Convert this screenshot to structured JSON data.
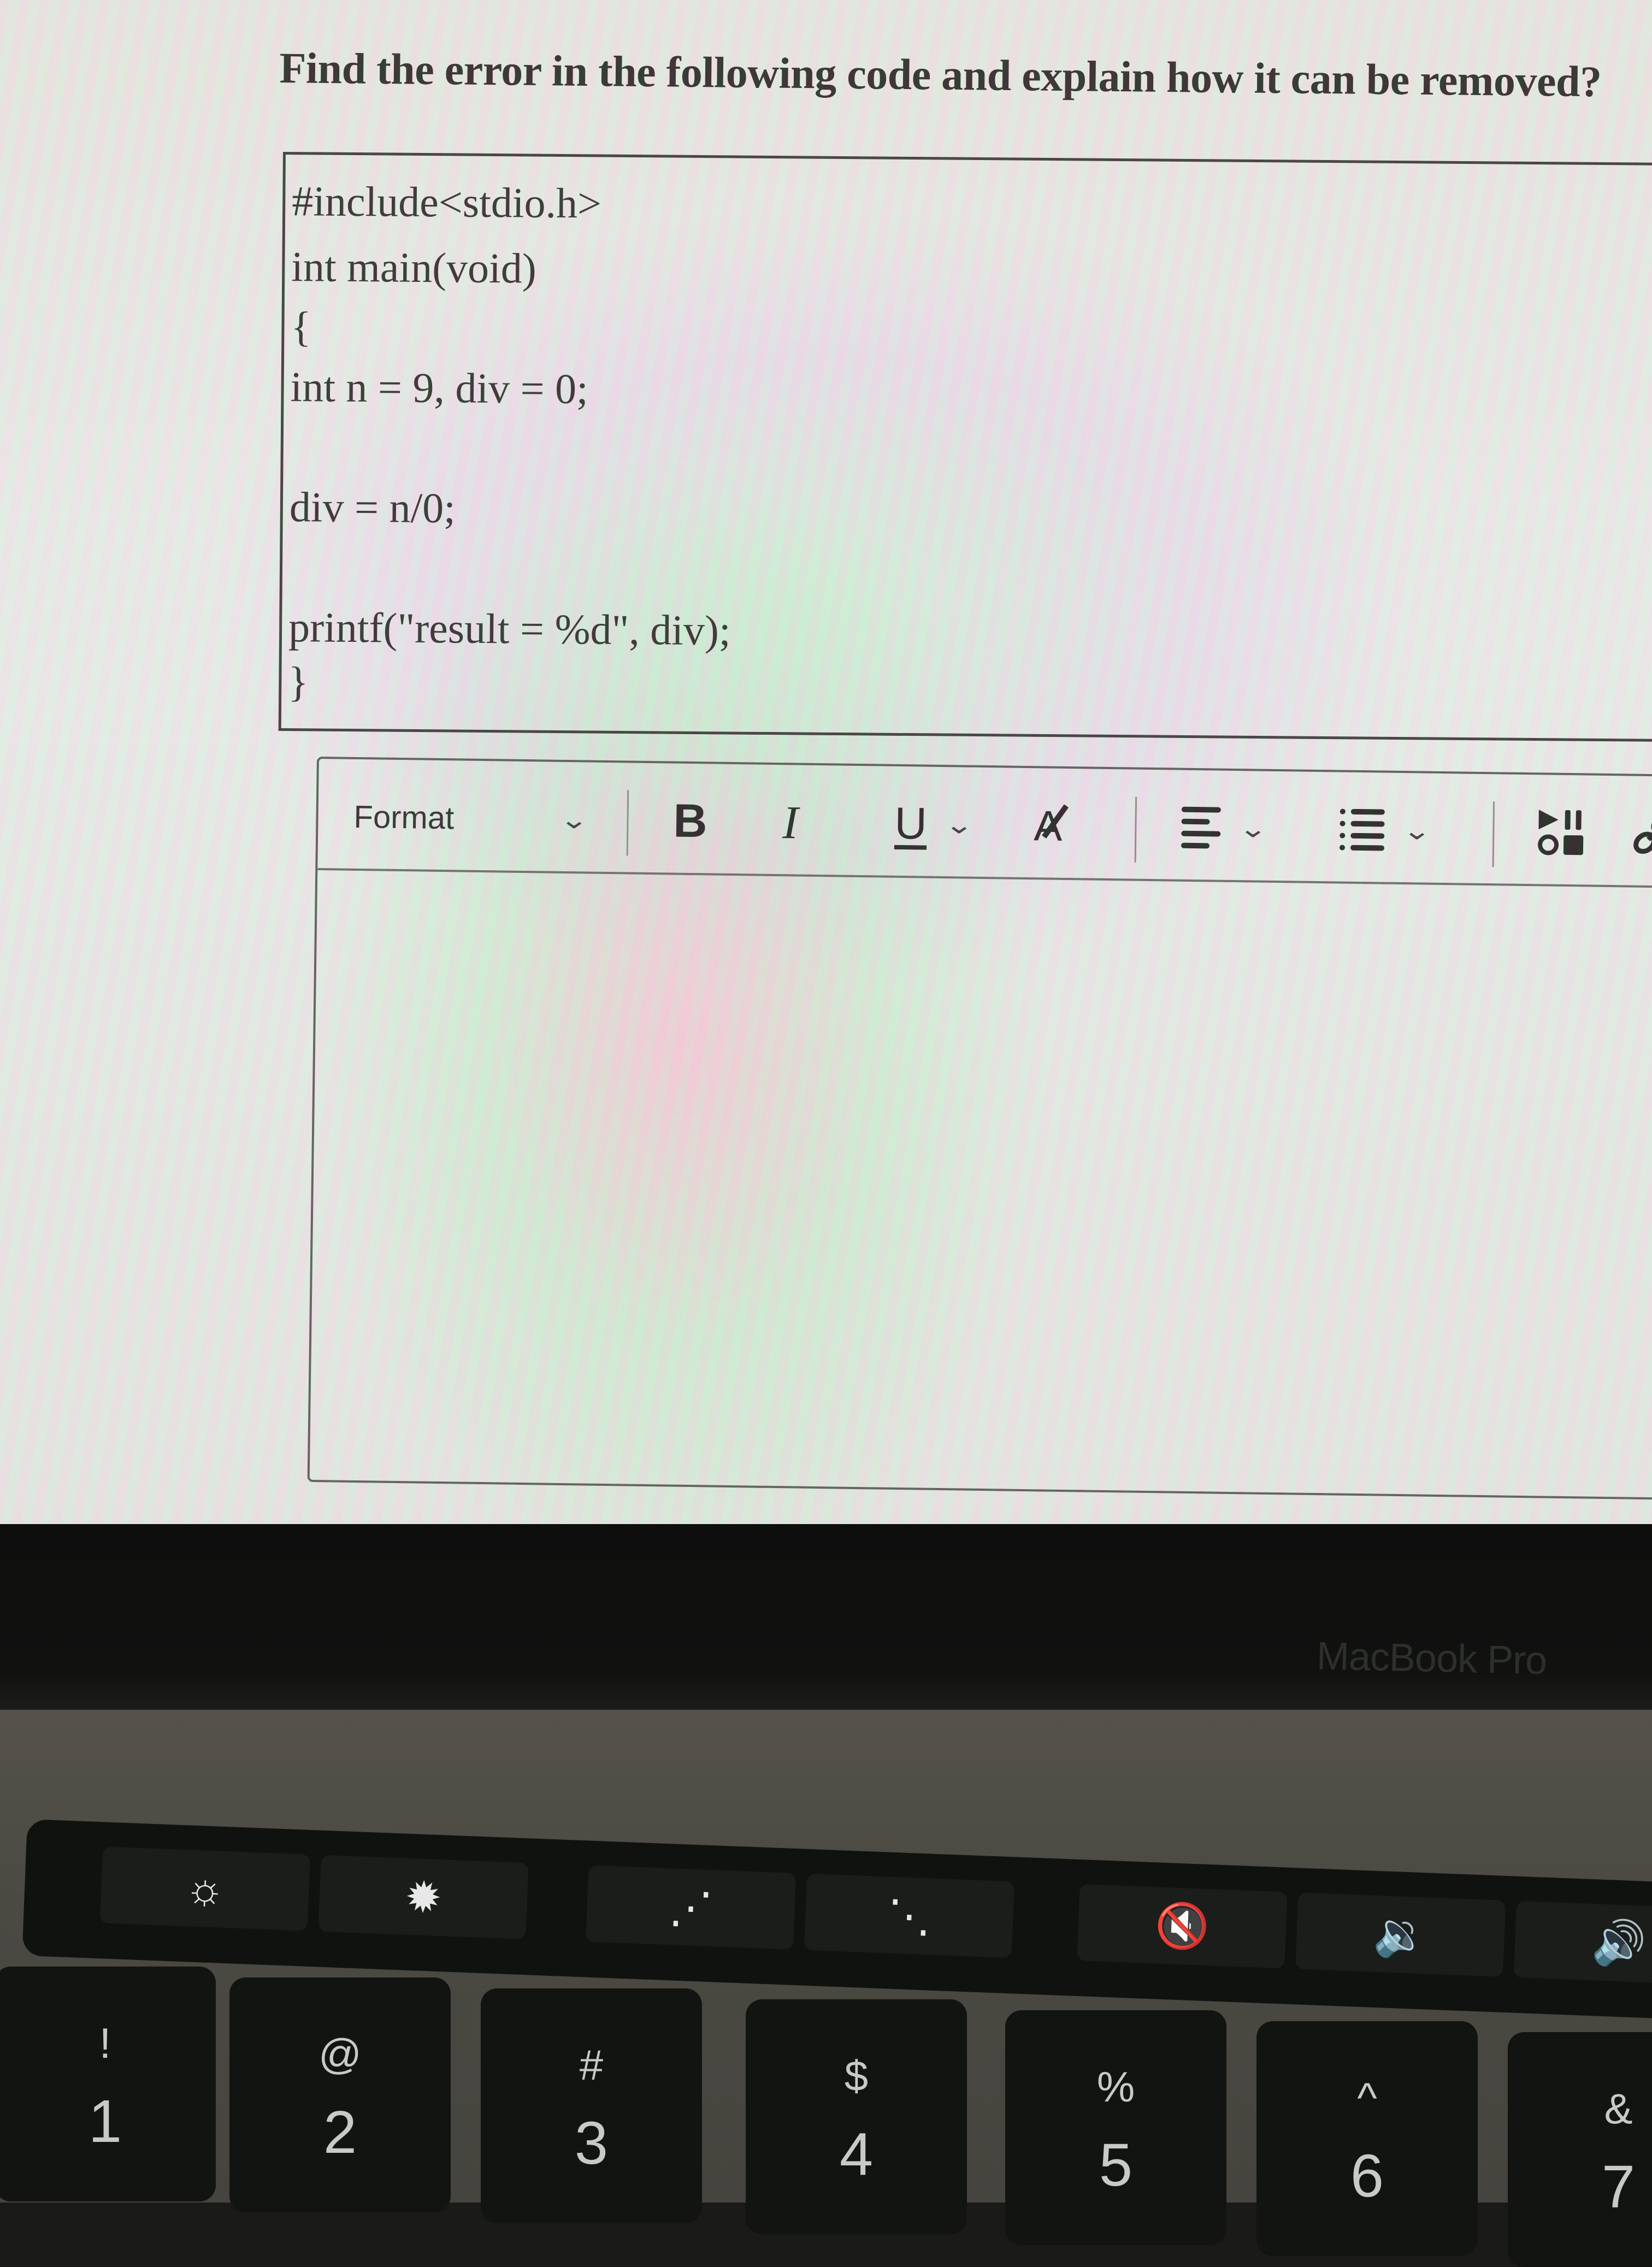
{
  "question": {
    "text": "Find the error in the following code and explain how it can be removed?"
  },
  "code": {
    "lines": [
      "#include<stdio.h>",
      "int main(void)",
      "{",
      "int n = 9, div = 0;",
      "div = n/0;",
      "printf(\"result = %d\", div);",
      "}"
    ]
  },
  "editor": {
    "toolbar": {
      "format_label": "Format",
      "format_chevron": "⌄",
      "bold_label": "B",
      "italic_label": "I",
      "underline_label": "U",
      "underline_chevron": "⌄",
      "clear_format_label": "A",
      "align_chevron": "⌄",
      "list_chevron": "⌄",
      "media_icon": "media-icon",
      "link_icon": "link-icon"
    },
    "body": {
      "value": "",
      "placeholder": ""
    }
  },
  "device": {
    "brand": "MacBook Pro"
  },
  "touchbar": {
    "keys": [
      {
        "icon": "brightness-down-icon",
        "glyph": "☼"
      },
      {
        "icon": "brightness-up-icon",
        "glyph": "✹"
      },
      {
        "icon": "keyboard-backlight-down-icon",
        "glyph": "⋰"
      },
      {
        "icon": "keyboard-backlight-up-icon",
        "glyph": "⋱"
      },
      {
        "icon": "mute-icon",
        "glyph": "🔇"
      },
      {
        "icon": "volume-down-icon",
        "glyph": "🔉"
      },
      {
        "icon": "volume-up-icon",
        "glyph": "🔊"
      }
    ]
  },
  "keyboard": {
    "keys": [
      {
        "shift": "!",
        "main": "1"
      },
      {
        "shift": "@",
        "main": "2"
      },
      {
        "shift": "#",
        "main": "3"
      },
      {
        "shift": "$",
        "main": "4"
      },
      {
        "shift": "%",
        "main": "5"
      },
      {
        "shift": "^",
        "main": "6"
      },
      {
        "shift": "&",
        "main": "7"
      }
    ]
  }
}
